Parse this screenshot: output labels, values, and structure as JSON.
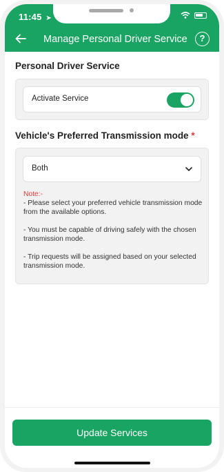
{
  "status_bar": {
    "time": "11:45",
    "location_icon": "location-arrow-icon",
    "wifi_icon": "wifi-icon",
    "battery_icon": "battery-icon"
  },
  "header": {
    "title": "Manage Personal Driver Service",
    "back_icon": "back-arrow-icon",
    "help_icon": "help-icon",
    "help_glyph": "?",
    "background_color": "#1aa463"
  },
  "personal_driver": {
    "section_title": "Personal Driver Service",
    "activate_label": "Activate Service",
    "activate_on": true
  },
  "transmission": {
    "section_title": "Vehicle's Preferred Transmission mode",
    "required_marker": "*",
    "selected_value": "Both",
    "note_label": "Note:-",
    "note_lines": [
      "- Please select your preferred vehicle transmission mode from the available options.",
      "- You must be capable of driving safely with the chosen transmission mode.",
      "- Trip requests will be assigned based on your selected transmission mode."
    ]
  },
  "footer": {
    "update_label": "Update Services"
  },
  "colors": {
    "accent": "#1aa463",
    "required": "#e53935"
  }
}
